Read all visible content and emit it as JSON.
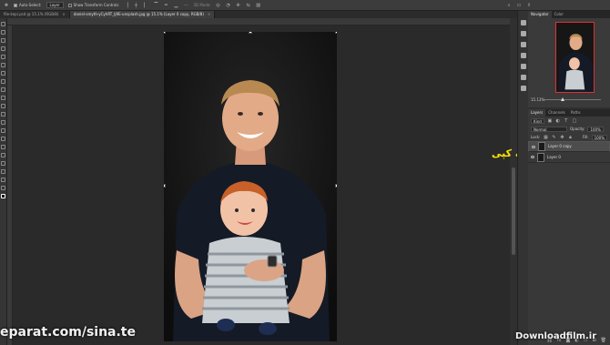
{
  "options_bar": {
    "auto_select_label": "Auto-Select:",
    "auto_select_value": "Layer",
    "transform_label": "Show Transform Controls",
    "mode_label": "3D Mode:"
  },
  "tabs": [
    {
      "label": "file-kepi.psd @ 15.1% (RGB/8)",
      "close": "×"
    },
    {
      "label": "daniel-smyth-yCyhRT_Ij9E-unsplash.jpg @ 15.1% (Layer 0 copy, RGB/8)",
      "close": "×"
    }
  ],
  "annotation_text": "لایه کپی",
  "watermark": "eparat.com/sina.te",
  "brand": "Downloadfilm.ir",
  "navigator": {
    "tabs": [
      "Navigator",
      "Color"
    ],
    "zoom": "15.13%"
  },
  "layers_panel": {
    "tabs": [
      "Layers",
      "Channels",
      "Paths"
    ],
    "kind_label": "Kind",
    "blend_mode": "Normal",
    "opacity_label": "Opacity:",
    "opacity_value": "100%",
    "lock_label": "Lock:",
    "fill_label": "Fill:",
    "fill_value": "100%",
    "layers": [
      {
        "name": "Layer 0 copy",
        "selected": true
      },
      {
        "name": "Layer 0",
        "selected": false
      }
    ]
  },
  "colors": {
    "accent_annotation": "#ffe600",
    "navigator_frame": "#e03030",
    "selected_layer": "#4d4d4d"
  }
}
